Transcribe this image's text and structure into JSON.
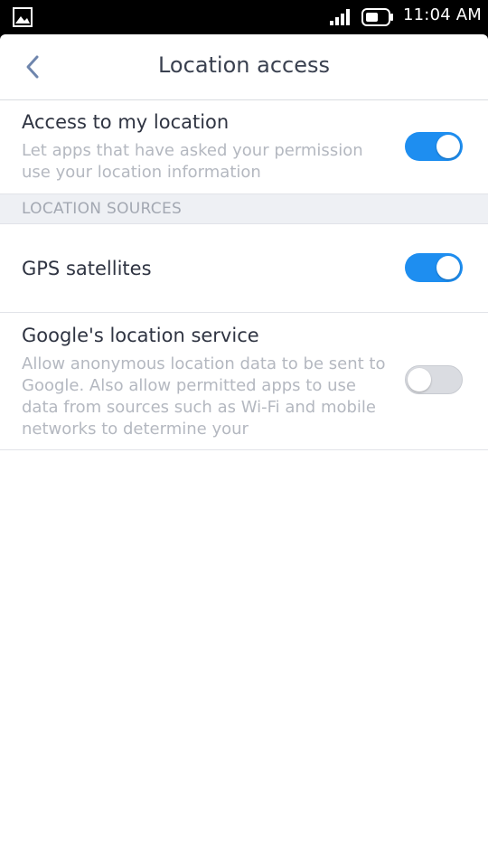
{
  "status_bar": {
    "time": "11:04 AM",
    "icons": [
      "image-icon",
      "signal-icon",
      "battery-icon"
    ]
  },
  "app_bar": {
    "title": "Location access",
    "back_icon": "chevron-left-icon"
  },
  "settings": {
    "access_location": {
      "title": "Access to my location",
      "description": "Let apps that have asked your permission use your location information",
      "enabled": true
    },
    "section_header": "LOCATION SOURCES",
    "gps": {
      "title": "GPS satellites",
      "enabled": true
    },
    "google_service": {
      "title": "Google's location service",
      "description": "Allow anonymous location data to be sent to Google. Also allow permitted apps to use data from sources such as Wi-Fi and mobile networks to determine your",
      "enabled": false
    }
  },
  "colors": {
    "accent": "#1e8ef0",
    "toggle_off": "#dadce1",
    "title_text": "#2f3442",
    "secondary_text": "#b4b8c0",
    "section_bg": "#eef0f4"
  }
}
